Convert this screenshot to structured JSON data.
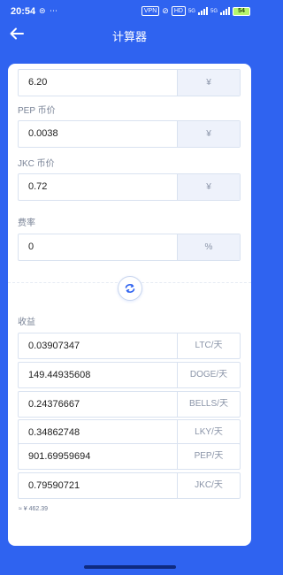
{
  "status_bar": {
    "time": "20:54",
    "left_icons": "⊜ ⋯",
    "net_chip": "VPN",
    "hd_chip": "HD",
    "gen1": "5G",
    "gen2": "5G",
    "battery": "54"
  },
  "header": {
    "title": "计算器"
  },
  "fields": [
    {
      "label": "",
      "value": "6.20",
      "unit": "¥"
    },
    {
      "label": "PEP 币价",
      "value": "0.0038",
      "unit": "¥"
    },
    {
      "label": "JKC 币价",
      "value": "0.72",
      "unit": "¥"
    },
    {
      "label": "费率",
      "value": "0",
      "unit": "%"
    }
  ],
  "income": {
    "label": "收益",
    "rows": [
      {
        "value": "0.03907347",
        "unit": "LTC/天"
      },
      {
        "value": "149.44935608",
        "unit": "DOGE/天"
      },
      {
        "value": "0.24376667",
        "unit": "BELLS/天"
      },
      {
        "value": "0.34862748",
        "unit": "LKY/天"
      },
      {
        "value": "901.69959694",
        "unit": "PEP/天"
      },
      {
        "value": "0.79590721",
        "unit": "JKC/天"
      }
    ],
    "total": "≈ ¥ 462.39"
  },
  "icons": {
    "back": "arrow-left-icon",
    "swap": "refresh-swap-icon"
  },
  "colors": {
    "primary": "#2f63f0",
    "unit_bg": "#eef2fb"
  }
}
